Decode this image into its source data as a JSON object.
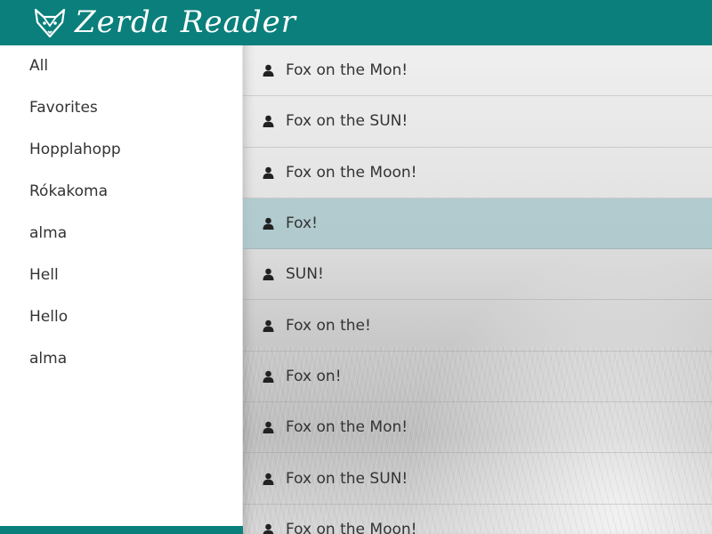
{
  "header": {
    "title": "Zerda Reader",
    "logo_icon": "fox-logo-icon",
    "background": "#0a7f7b"
  },
  "sidebar": {
    "items": [
      {
        "label": "All"
      },
      {
        "label": "Favorites"
      },
      {
        "label": "Hopplahopp"
      },
      {
        "label": "Rókakoma"
      },
      {
        "label": "alma"
      },
      {
        "label": "Hell"
      },
      {
        "label": "Hello"
      },
      {
        "label": "alma"
      }
    ]
  },
  "feed": {
    "item_icon": "user-icon",
    "selected_color": "#a8c7cb",
    "items": [
      {
        "title": "Fox on the Mon!",
        "selected": false
      },
      {
        "title": "Fox on the SUN!",
        "selected": false
      },
      {
        "title": "Fox on the Moon!",
        "selected": false
      },
      {
        "title": "Fox!",
        "selected": true
      },
      {
        "title": "SUN!",
        "selected": false
      },
      {
        "title": "Fox on the!",
        "selected": false
      },
      {
        "title": "Fox on!",
        "selected": false
      },
      {
        "title": "Fox on the Mon!",
        "selected": false
      },
      {
        "title": "Fox on the SUN!",
        "selected": false
      },
      {
        "title": "Fox on the Moon!",
        "selected": false
      }
    ]
  }
}
